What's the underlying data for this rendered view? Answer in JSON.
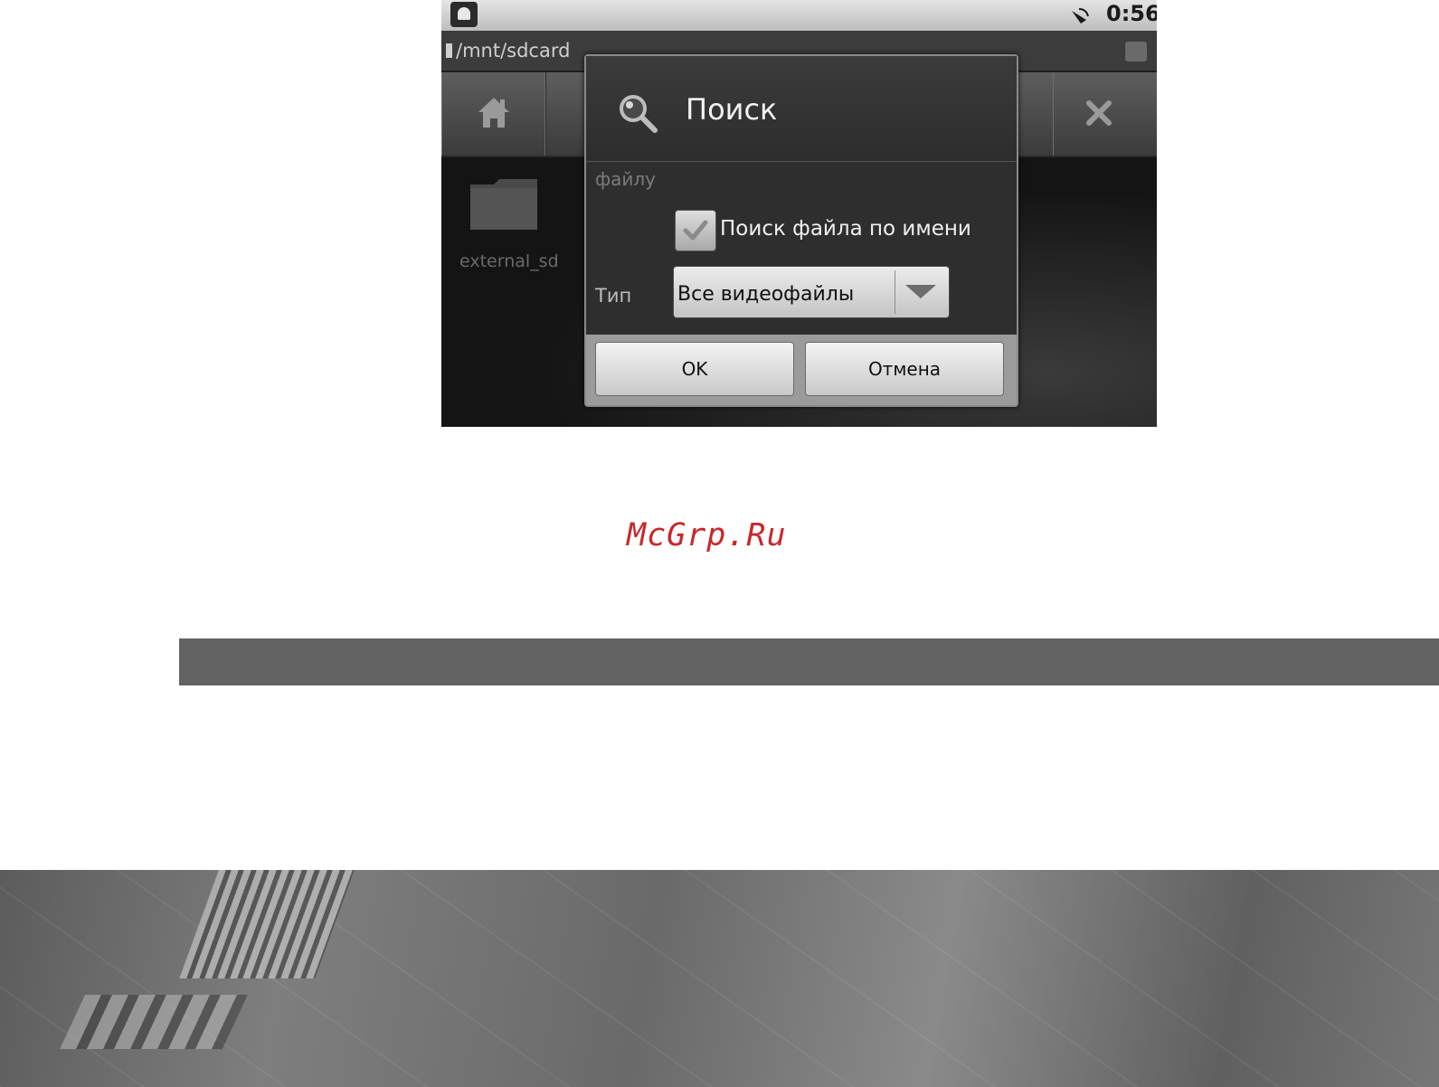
{
  "status_bar": {
    "time": "0:56"
  },
  "path_bar": {
    "path": "/mnt/sdcard"
  },
  "toolbar": {
    "home_icon": "home-icon",
    "close_icon": "close-icon"
  },
  "files": [
    {
      "name": "external_sd",
      "icon": "folder-icon"
    }
  ],
  "dialog": {
    "title": "Поиск",
    "icon": "search-icon",
    "scroll_text": "файлу",
    "checkbox": {
      "label": "Поиск файла по имени",
      "checked": true
    },
    "type": {
      "label": "Тип",
      "value": "Все видеофайлы"
    },
    "buttons": {
      "ok": "OK",
      "cancel": "Отмена"
    }
  },
  "watermark": "McGrp.Ru",
  "colors": {
    "watermark": "#c8282c",
    "band": "#636363"
  }
}
